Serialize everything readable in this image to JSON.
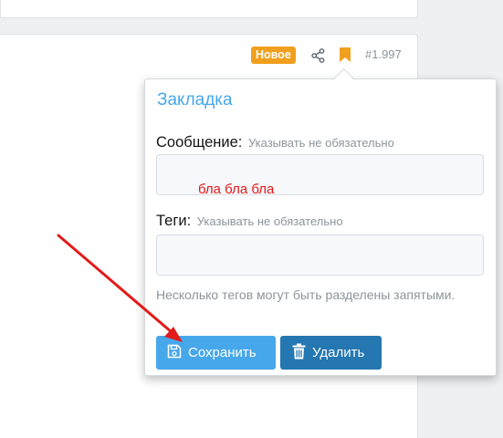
{
  "post": {
    "badge": "Новое",
    "share_icon": "share-icon",
    "bookmark_icon": "bookmark-icon",
    "number": "#1.997",
    "colors": {
      "badge": "#f0a01e",
      "bookmark": "#f0a01e"
    }
  },
  "bookmark_popup": {
    "title": "Закладка",
    "message_label": "Сообщение:",
    "message_hint": "Указывать не обязательно",
    "message_value": "бла бла бла",
    "tags_label": "Теги:",
    "tags_hint": "Указывать не обязательно",
    "tags_value": "",
    "tags_note": "Несколько тегов могут быть разделены запятыми.",
    "save_button": "Сохранить",
    "save_icon": "floppy-disk-icon",
    "delete_button": "Удалить",
    "delete_icon": "trash-icon",
    "colors": {
      "title": "#47a7eb",
      "save": "#47a7eb",
      "delete": "#2577b1",
      "annotation": "#e31a1a"
    }
  }
}
